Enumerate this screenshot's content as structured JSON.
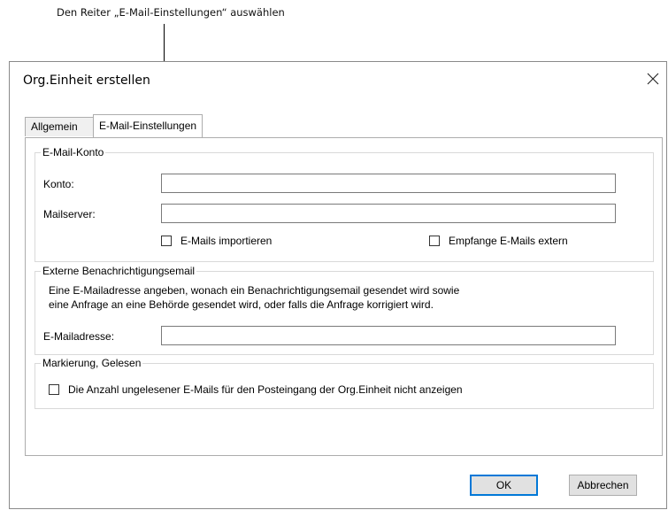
{
  "callout": {
    "text": "Den Reiter „E-Mail-Einstellungen“ auswählen"
  },
  "dialog": {
    "title": "Org.Einheit erstellen",
    "close_icon": "close-icon",
    "tabs": [
      {
        "label": "Allgemein",
        "active": false
      },
      {
        "label": "E-Mail-Einstellungen",
        "active": true
      }
    ],
    "email_account": {
      "legend": "E-Mail-Konto",
      "konto_label": "Konto:",
      "konto_value": "",
      "mailserver_label": "Mailserver:",
      "mailserver_value": "",
      "import_label": "E-Mails importieren",
      "import_checked": false,
      "extern_label": "Empfange E-Mails extern",
      "extern_checked": false
    },
    "notify": {
      "legend": "Externe Benachrichtigungsemail",
      "description_line1": "Eine E-Mailadresse angeben, wonach ein Benachrichtigungsemail gesendet wird sowie",
      "description_line2": "eine Anfrage an eine Behörde gesendet wird, oder falls die Anfrage korrigiert wird.",
      "address_label": "E-Mailadresse:",
      "address_value": ""
    },
    "marking": {
      "legend": "Markierung, Gelesen",
      "hide_unread_label": "Die Anzahl ungelesener E-Mails für den Posteingang der Org.Einheit nicht anzeigen",
      "hide_unread_checked": false
    },
    "buttons": {
      "ok": "OK",
      "cancel": "Abbrechen"
    }
  }
}
